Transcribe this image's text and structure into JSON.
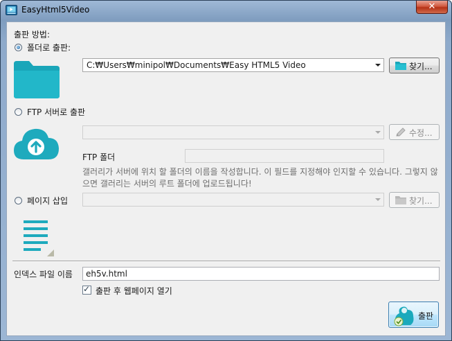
{
  "window": {
    "title": "EasyHtml5Video",
    "close_glyph": "✕"
  },
  "publish_method": {
    "section_label": "출판 방법:",
    "folder_option": {
      "label": "폴더로 출판:",
      "selected": true,
      "path_value": "C:₩Users₩minipol₩Documents₩Easy HTML5 Video",
      "browse_label": "찾기...",
      "icon": "folder-icon"
    },
    "ftp_option": {
      "label": "FTP 서버로 출판",
      "selected": false,
      "server_value": "",
      "edit_label": "수정...",
      "folder_label": "FTP 폴더",
      "folder_value": "",
      "hint": "갤러리가 서버에 위치 할 폴더의 이름을 작성합니다. 이 필드를 지정해야 인지할 수 있습니다. 그렇지 않으면 갤러리는 서버의 루트 폴더에 업로드됩니다!",
      "icon": "cloud-upload-icon"
    },
    "page_option": {
      "label": "페이지 삽입",
      "selected": false,
      "page_value": "",
      "browse_label": "찾기...",
      "icon": "document-icon"
    }
  },
  "index_file": {
    "label": "인덱스 파일 이름",
    "value": "eh5v.html"
  },
  "open_after": {
    "label": "출판 후 웹페이지 열기",
    "checked": true
  },
  "publish_button": {
    "label": "출판"
  },
  "colors": {
    "accent": "#1fb2c6",
    "titlebar": "#8eaacb",
    "close": "#c8482b"
  }
}
